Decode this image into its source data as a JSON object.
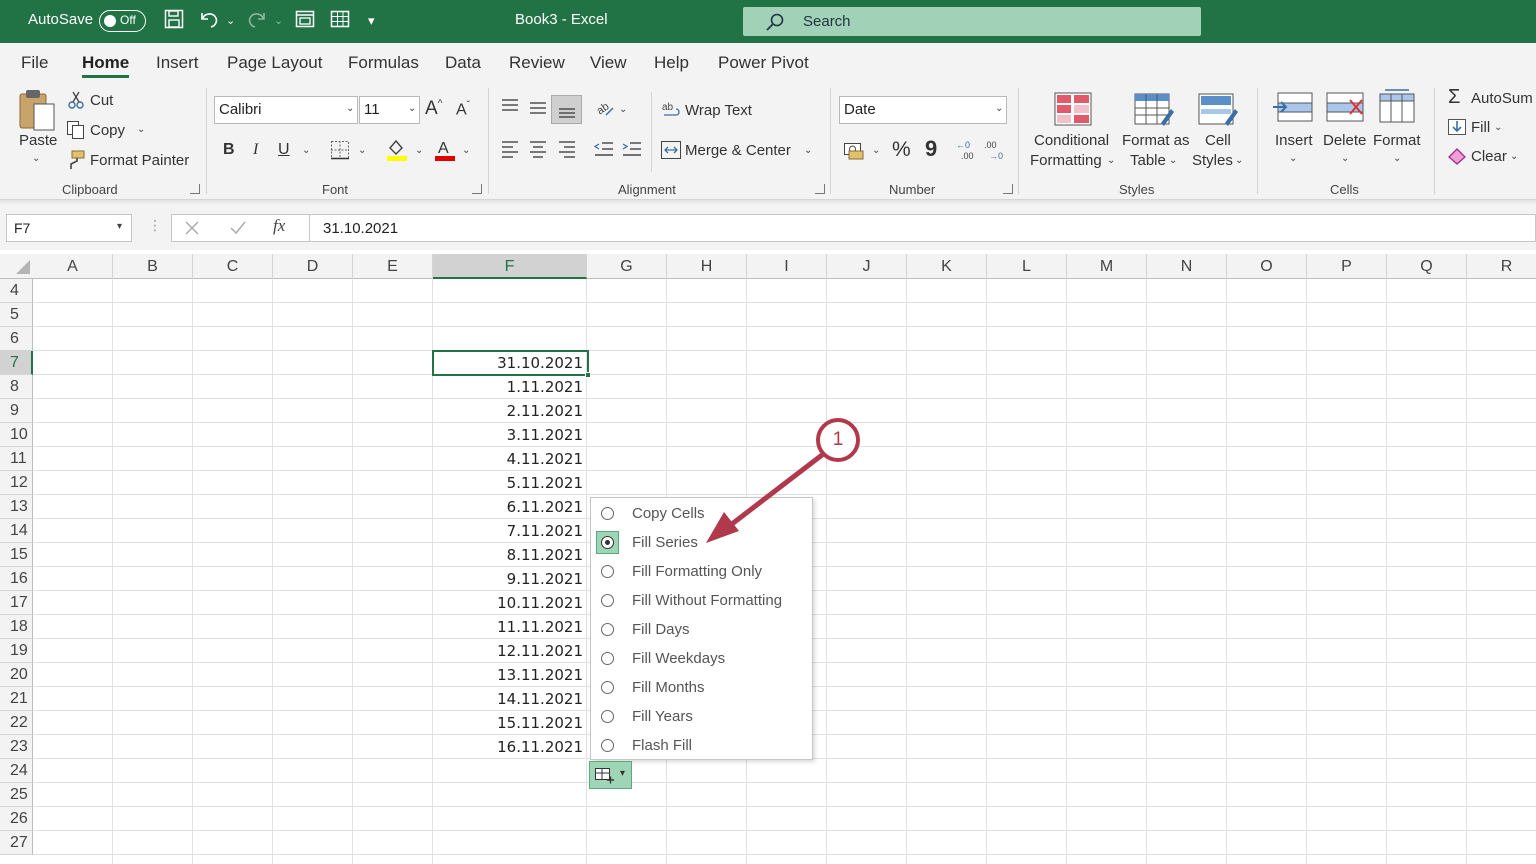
{
  "titlebar": {
    "autosave_label": "AutoSave",
    "autosave_state": "Off",
    "title": "Book3 - Excel",
    "search_placeholder": "Search"
  },
  "tabs": [
    "File",
    "Home",
    "Insert",
    "Page Layout",
    "Formulas",
    "Data",
    "Review",
    "View",
    "Help",
    "Power Pivot"
  ],
  "active_tab": "Home",
  "ribbon": {
    "clipboard": {
      "paste": "Paste",
      "cut": "Cut",
      "copy": "Copy",
      "format_painter": "Format Painter",
      "group": "Clipboard"
    },
    "font": {
      "name": "Calibri",
      "size": "11",
      "bold": "B",
      "italic": "I",
      "underline": "U",
      "group": "Font"
    },
    "alignment": {
      "wrap_text": "Wrap Text",
      "merge_center": "Merge & Center",
      "group": "Alignment"
    },
    "number": {
      "format": "Date",
      "percent": "%",
      "comma": "9",
      "group": "Number"
    },
    "styles": {
      "conditional_1": "Conditional",
      "conditional_2": "Formatting",
      "format_table_1": "Format as",
      "format_table_2": "Table",
      "cell_styles_1": "Cell",
      "cell_styles_2": "Styles",
      "group": "Styles"
    },
    "cells": {
      "insert": "Insert",
      "delete": "Delete",
      "format": "Format",
      "group": "Cells"
    },
    "editing": {
      "autosum": "AutoSum",
      "fill": "Fill",
      "clear": "Clear"
    }
  },
  "formula_bar": {
    "name_box": "F7",
    "fx": "fx",
    "value": "31.10.2021"
  },
  "columns": [
    "A",
    "B",
    "C",
    "D",
    "E",
    "F",
    "G",
    "H",
    "I",
    "J",
    "K",
    "L",
    "M",
    "N",
    "O",
    "P",
    "Q",
    "R"
  ],
  "rows": [
    "4",
    "5",
    "6",
    "7",
    "8",
    "9",
    "10",
    "11",
    "12",
    "13",
    "14",
    "15",
    "16",
    "17",
    "18",
    "19",
    "20",
    "21",
    "22",
    "23",
    "24",
    "25",
    "26",
    "27"
  ],
  "column_f_values": [
    "31.10.2021",
    "1.11.2021",
    "2.11.2021",
    "3.11.2021",
    "4.11.2021",
    "5.11.2021",
    "6.11.2021",
    "7.11.2021",
    "8.11.2021",
    "9.11.2021",
    "10.11.2021",
    "11.11.2021",
    "12.11.2021",
    "13.11.2021",
    "14.11.2021",
    "15.11.2021",
    "16.11.2021"
  ],
  "autofill_menu": {
    "items": [
      "Copy Cells",
      "Fill Series",
      "Fill Formatting Only",
      "Fill Without Formatting",
      "Fill Days",
      "Fill Weekdays",
      "Fill Months",
      "Fill Years",
      "Flash Fill"
    ],
    "selected": "Fill Series"
  },
  "callout": {
    "number": "1",
    "color": "#b0394c"
  },
  "colors": {
    "excel_green": "#217346",
    "selection_green": "#9fd5b7"
  }
}
